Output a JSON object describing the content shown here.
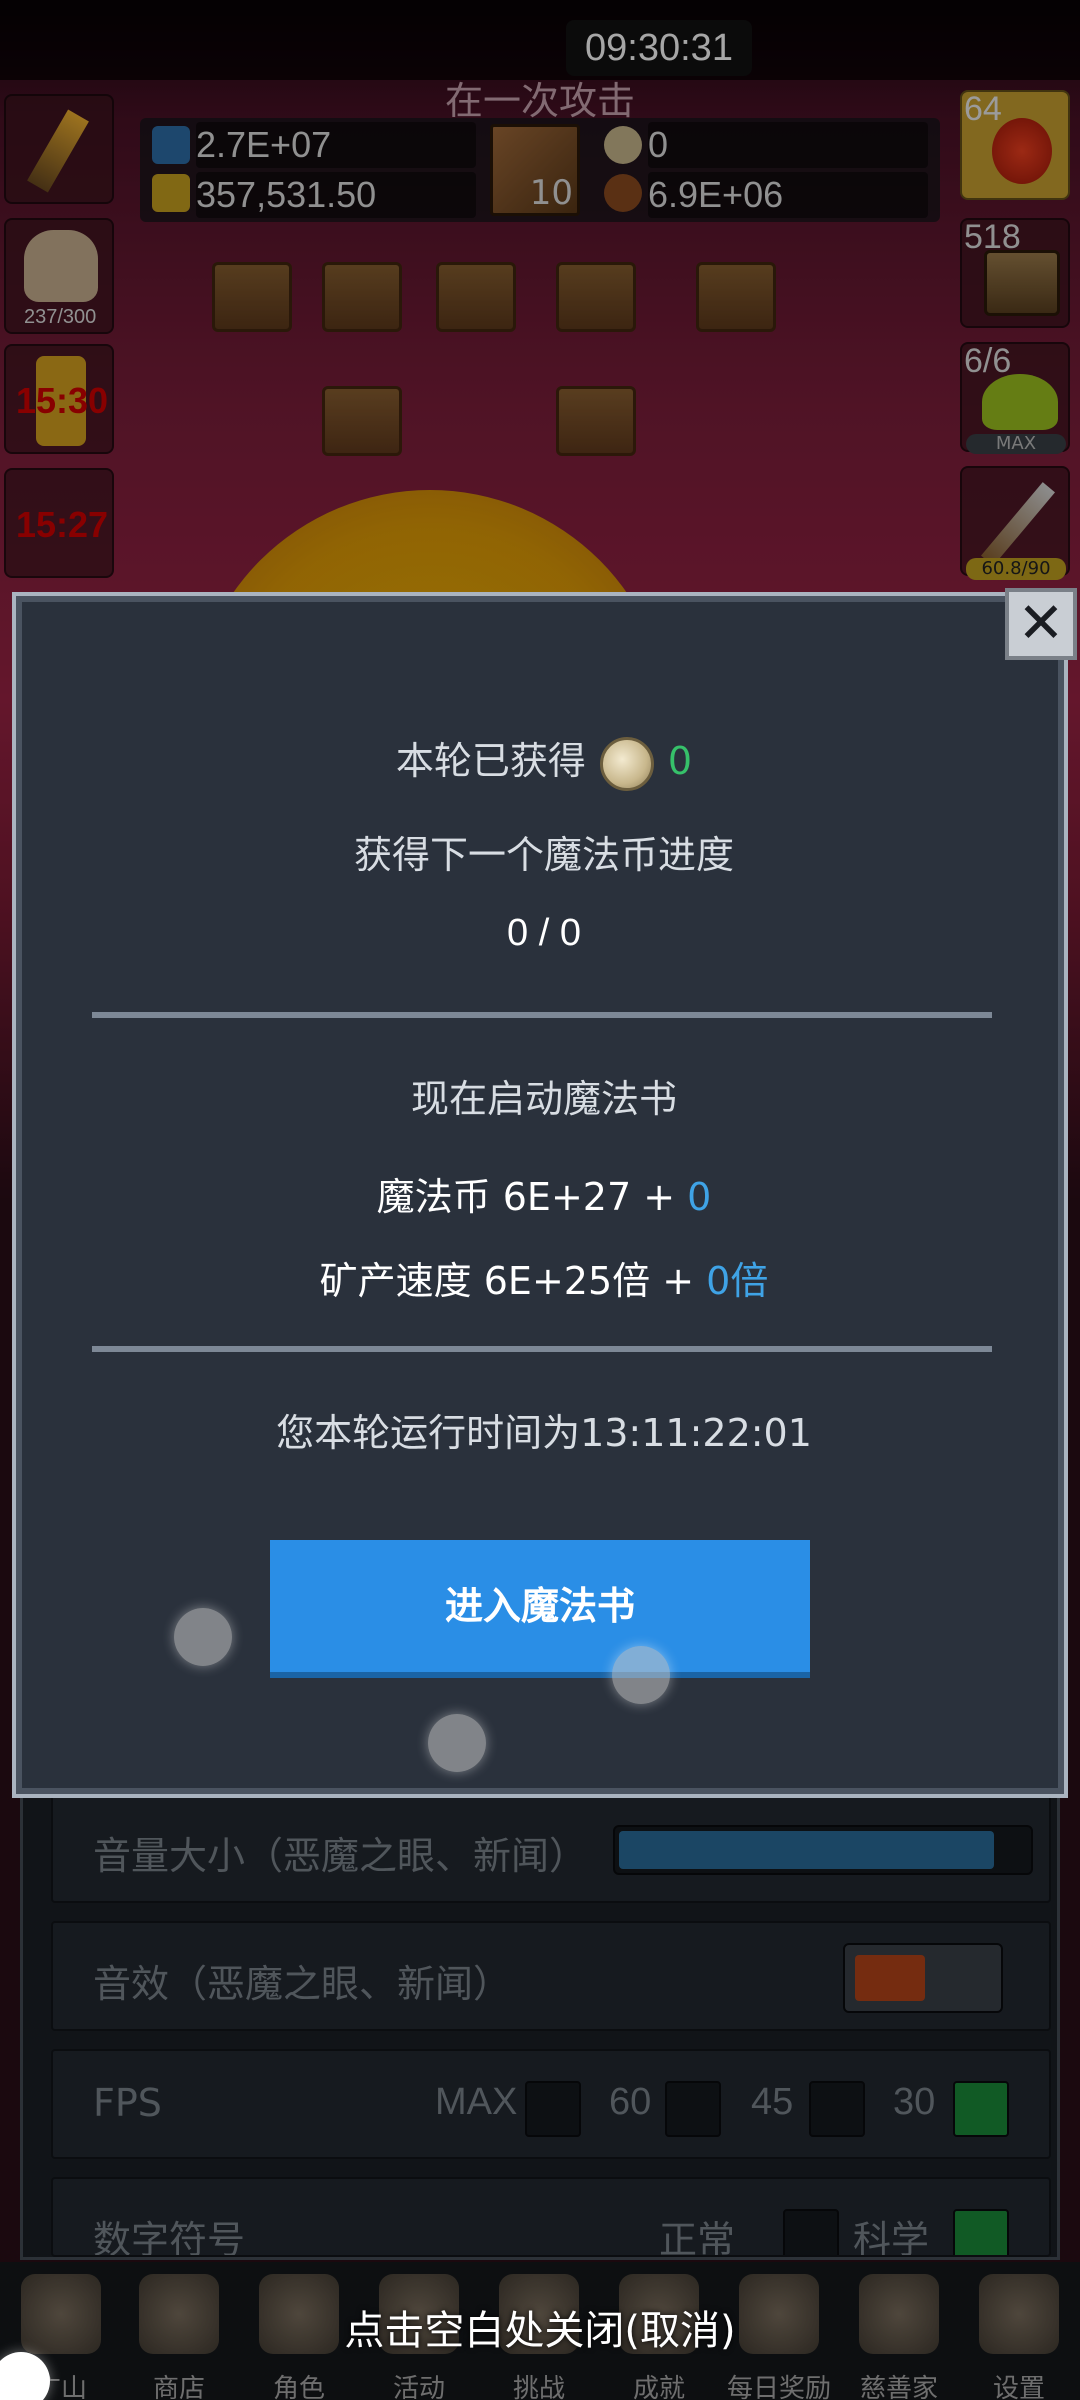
{
  "status_bar": {
    "time": "09:30:31"
  },
  "scene": {
    "title": "在一次攻击",
    "resources": {
      "potion": "2.7E+07",
      "gold": "357,531.50",
      "book_level": "10",
      "coin": "0",
      "meat": "6.9E+06"
    },
    "left_column": {
      "storage_count": "237/300",
      "timer_1": "15:30",
      "timer_2": "15:27"
    },
    "right_column": {
      "potion_count": "64",
      "chest_count": "518",
      "slime_count": "6/6",
      "slime_badge": "MAX",
      "sword_progress": "60.8/90"
    }
  },
  "dialog": {
    "earned_label": "本轮已获得",
    "earned_value": "0",
    "progress_label": "获得下一个魔法币进度",
    "progress_value": "0 / 0",
    "start_label": "现在启动魔法书",
    "magic_coin_text": "魔法币 6E+27 + ",
    "magic_coin_bonus": "0",
    "mine_speed_text": "矿产速度 6E+25倍 + ",
    "mine_speed_bonus": "0倍",
    "runtime_text": "您本轮运行时间为13:11:22:01",
    "enter_button": "进入魔法书",
    "close_icon": "close-x-icon"
  },
  "settings": {
    "volume_label": "音量大小（恶魔之眼、新闻）",
    "volume_level": 0.92,
    "sfx_label": "音效（恶魔之眼、新闻）",
    "fps_label": "FPS",
    "fps_options": [
      "MAX",
      "60",
      "45",
      "30"
    ],
    "fps_selected": "30",
    "number_label": "数字符号",
    "number_options": [
      "正常",
      "科学"
    ],
    "number_selected": "科学"
  },
  "bottom_nav": {
    "close_hint": "点击空白处关闭(取消)",
    "items": [
      "广山",
      "商店",
      "角色",
      "活动",
      "挑战",
      "成就",
      "每日奖励",
      "慈善家",
      "设置"
    ]
  },
  "colors": {
    "accent": "#2a8ee6",
    "green": "#36c16a",
    "blue": "#3fa3e6",
    "dialog_bg": "#2a313c"
  }
}
